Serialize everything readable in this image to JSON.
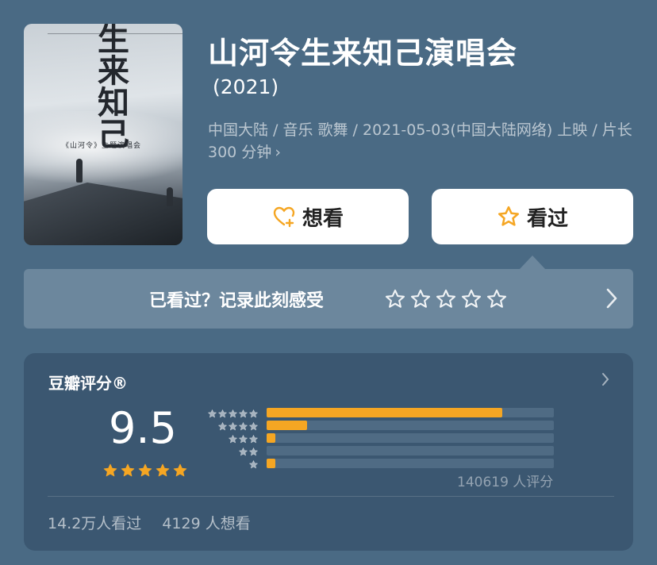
{
  "poster": {
    "calligraphy": "生来知己",
    "subtitle": "《山河令》主题演唱会"
  },
  "title": "山河令生来知己演唱会",
  "year": "(2021)",
  "meta": "中国大陆 / 音乐 歌舞 / 2021-05-03(中国大陆网络) 上映 / 片长 300 分钟",
  "meta_chevron": "›",
  "buttons": {
    "want_label": "想看",
    "seen_label": "看过"
  },
  "record": {
    "label": "已看过？记录此刻感受",
    "star_count": 5
  },
  "rating": {
    "heading": "豆瓣评分®",
    "score": "9.5",
    "stars": 5,
    "distribution": [
      {
        "stars": 5,
        "fraction": 0.82
      },
      {
        "stars": 4,
        "fraction": 0.14
      },
      {
        "stars": 3,
        "fraction": 0.03
      },
      {
        "stars": 2,
        "fraction": 0.0
      },
      {
        "stars": 1,
        "fraction": 0.03
      }
    ],
    "count": "140619 人评分",
    "watched": "14.2万人看过",
    "wish": "4129 人想看"
  },
  "colors": {
    "background": "#4a6a84",
    "accent": "#f5a623",
    "panel": "#3b5771",
    "record_bar": "#6c879d"
  },
  "icons": {
    "want": "heart-plus-icon",
    "seen": "star-outline-icon",
    "chevron": "chevron-right-icon"
  }
}
